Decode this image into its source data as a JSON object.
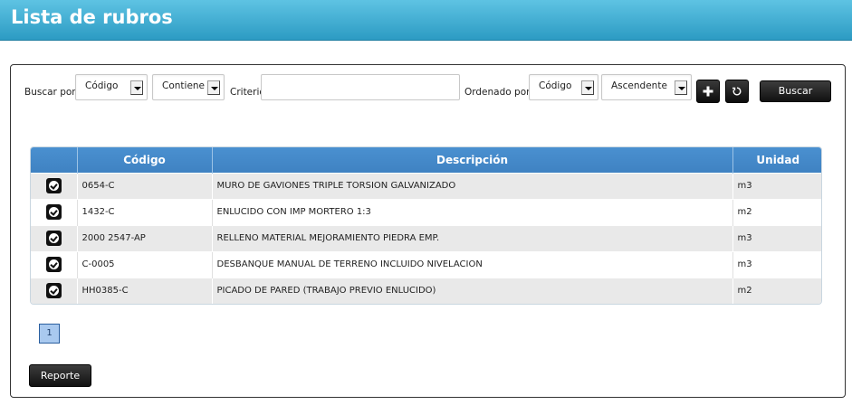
{
  "page": {
    "title": "Lista de rubros"
  },
  "search": {
    "buscar_por_label": "Buscar por:",
    "field_select": "Código",
    "condition_select": "Contiene",
    "criterio_label": "Criterio:",
    "criterio_value": "",
    "ordenado_por_label": "Ordenado por:",
    "order_field_select": "Código",
    "order_direction_select": "Ascendente",
    "add_icon": "plus-icon",
    "reset_icon": "refresh-icon",
    "buscar_button": "Buscar"
  },
  "table": {
    "columns": [
      "",
      "Código",
      "Descripción",
      "Unidad"
    ],
    "rows": [
      {
        "codigo": "0654-C",
        "descripcion": "MURO DE GAVIONES TRIPLE TORSION GALVANIZADO",
        "unidad": "m3"
      },
      {
        "codigo": "1432-C",
        "descripcion": "ENLUCIDO CON IMP MORTERO 1:3",
        "unidad": "m2"
      },
      {
        "codigo": "2000 2547-AP",
        "descripcion": "RELLENO MATERIAL MEJORAMIENTO PIEDRA EMP.",
        "unidad": "m3"
      },
      {
        "codigo": "C-0005",
        "descripcion": "DESBANQUE MANUAL DE TERRENO INCLUIDO NIVELACION",
        "unidad": "m3"
      },
      {
        "codigo": "HH0385-C",
        "descripcion": "PICADO DE PARED (TRABAJO PREVIO ENLUCIDO)",
        "unidad": "m2"
      }
    ]
  },
  "pagination": {
    "current_page": "1"
  },
  "footer": {
    "reporte_button": "Reporte"
  },
  "colors": {
    "header_top": "#5ec3e3",
    "header_bottom": "#2c9bc3",
    "table_header": "#4a90d0"
  }
}
